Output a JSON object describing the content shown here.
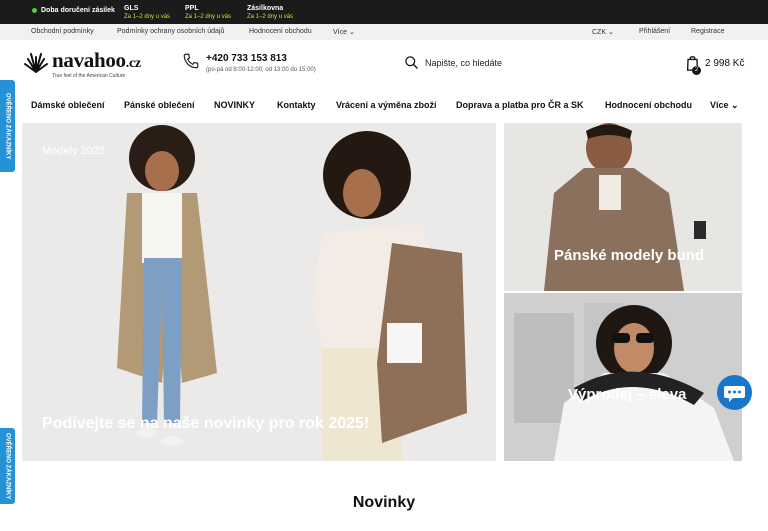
{
  "topbar": {
    "delivery_label": "Doba doručení zásilek",
    "carriers": [
      {
        "name": "GLS",
        "eta": "Za 1–2 dny u vás"
      },
      {
        "name": "PPL",
        "eta": "Za 1–2 dny u vás"
      },
      {
        "name": "Zásilkovna",
        "eta": "Za 1–2 dny u vás"
      }
    ]
  },
  "links": {
    "terms": "Obchodní podmínky",
    "privacy": "Podmínky ochrany osobních údajů",
    "reviews": "Hodnocení obchodu",
    "more": "Více",
    "currency": "CZK",
    "login": "Přihlášení",
    "register": "Registrace"
  },
  "logo": {
    "brand": "navahoo",
    "suffix": ".cz",
    "tagline": "True feel of the American Culture"
  },
  "phone": {
    "number": "+420 733 153 813",
    "hours": "(po-pá od 8:00-12:00, od 13:00 do 15:00)"
  },
  "search": {
    "placeholder": "Napište, co hledáte"
  },
  "cart": {
    "total": "2 998 Kč",
    "count": "2"
  },
  "nav": [
    "Dámské oblečení",
    "Pánské oblečení",
    "NOVINKY",
    "Kontakty",
    "Vrácení a výměna zboží",
    "Doprava a platba pro ČR a SK",
    "Hodnocení obchodu",
    "Více"
  ],
  "hero": {
    "subtitle": "Modely 2025",
    "caption": "Podívejte se na naše novinky pro rok 2025!"
  },
  "tiles": [
    {
      "caption": "Pánské modely bund"
    },
    {
      "caption": "Výprodej – sleva"
    }
  ],
  "side_badges": [
    "OVĚŘENO ZÁKAZNÍKY",
    "OVĚŘENO ZÁKAZNÍKY"
  ],
  "section": {
    "title": "Novinky"
  },
  "colors": {
    "topbar": "#1b1b1b",
    "accent_green": "#c7e33a",
    "badge_blue": "#2592d6",
    "chat_blue": "#1976c9"
  }
}
